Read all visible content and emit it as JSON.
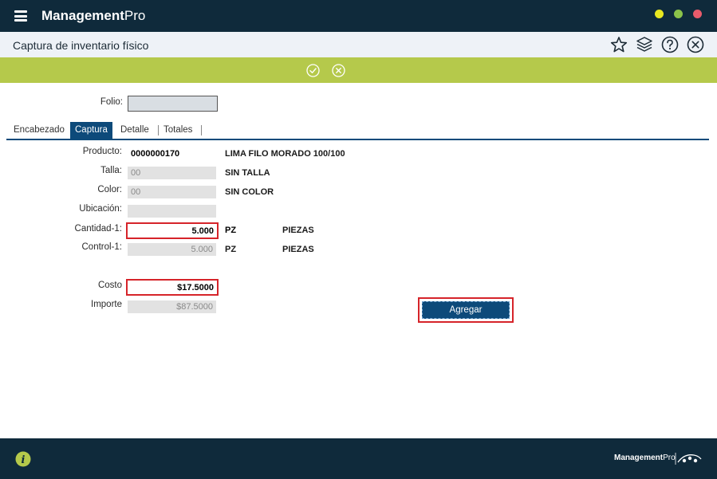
{
  "app": {
    "brand_main": "Management",
    "brand_pro": "Pro"
  },
  "titlebar": {
    "title": "Captura de inventario físico"
  },
  "form": {
    "folio_label": "Folio:",
    "folio_value": "",
    "tabs": [
      {
        "label": "Encabezado"
      },
      {
        "label": "Captura"
      },
      {
        "label": "Detalle"
      },
      {
        "label": "Totales"
      }
    ],
    "producto": {
      "label": "Producto:",
      "value": "0000000170",
      "desc": "LIMA FILO MORADO 100/100"
    },
    "talla": {
      "label": "Talla:",
      "value": "00",
      "desc": "SIN TALLA"
    },
    "color": {
      "label": "Color:",
      "value": "00",
      "desc": "SIN COLOR"
    },
    "ubicacion": {
      "label": "Ubicación:",
      "value": ""
    },
    "cantidad": {
      "label": "Cantidad-1:",
      "value": "5.000",
      "unit": "PZ",
      "unit_desc": "PIEZAS"
    },
    "control": {
      "label": "Control-1:",
      "value": "5.000",
      "unit": "PZ",
      "unit_desc": "PIEZAS"
    },
    "costo": {
      "label": "Costo",
      "value": "$17.5000"
    },
    "importe": {
      "label": "Importe",
      "value": "$87.5000"
    },
    "agregar_label": "Agregar"
  },
  "footer": {
    "brand_main": "Management",
    "brand_pro": "Pro"
  }
}
